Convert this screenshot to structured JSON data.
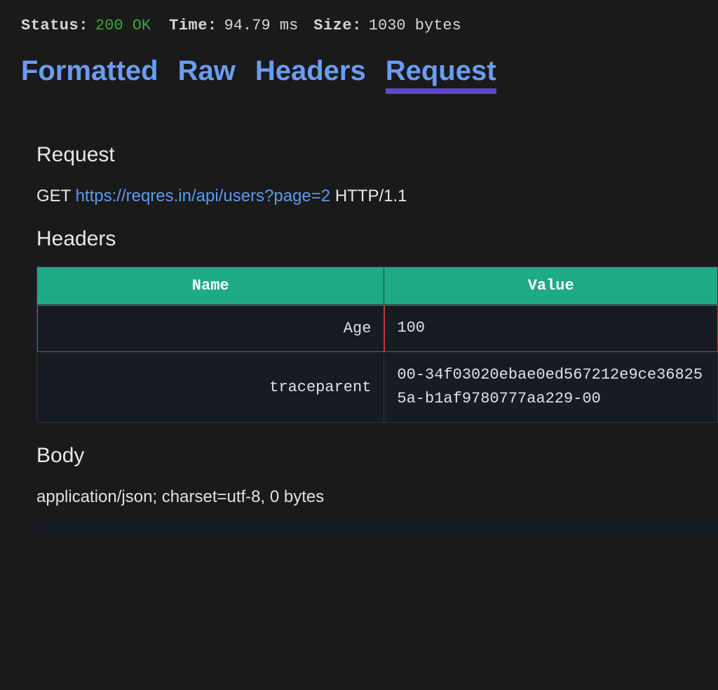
{
  "status": {
    "label": "Status:",
    "value": "200 OK",
    "time_label": "Time:",
    "time_value": "94.79 ms",
    "size_label": "Size:",
    "size_value": "1030 bytes"
  },
  "tabs": {
    "formatted": "Formatted",
    "raw": "Raw",
    "headers": "Headers",
    "request": "Request"
  },
  "request": {
    "section_title": "Request",
    "method": "GET",
    "url": "https://reqres.in/api/users?page=2",
    "protocol": "HTTP/1.1"
  },
  "headers_section": {
    "title": "Headers",
    "col_name": "Name",
    "col_value": "Value",
    "rows": [
      {
        "name": "Age",
        "value": "100"
      },
      {
        "name": "traceparent",
        "value": "00-34f03020ebae0ed567212e9ce368255a-b1af9780777aa229-00"
      }
    ]
  },
  "body": {
    "title": "Body",
    "meta": "application/json; charset=utf-8, 0 bytes"
  }
}
